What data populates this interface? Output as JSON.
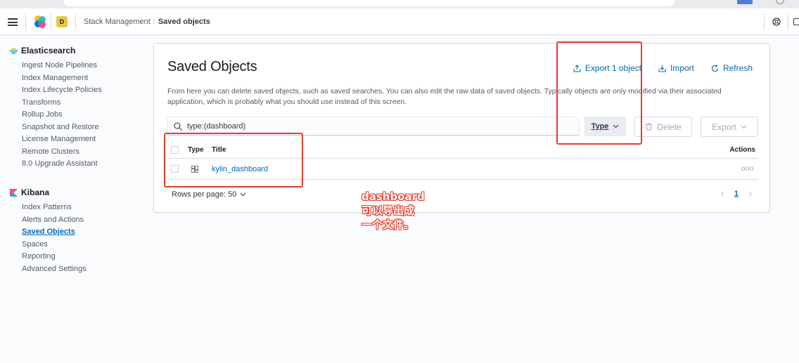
{
  "header": {
    "space_initial": "D",
    "breadcrumbs": [
      "Stack Management",
      "Saved objects"
    ]
  },
  "sidebar": {
    "sections": [
      {
        "title": "Elasticsearch",
        "icon": "elasticsearch-icon",
        "items": [
          "Ingest Node Pipelines",
          "Index Management",
          "Index Lifecycle Policies",
          "Transforms",
          "Rollup Jobs",
          "Snapshot and Restore",
          "License Management",
          "Remote Clusters",
          "8.0 Upgrade Assistant"
        ]
      },
      {
        "title": "Kibana",
        "icon": "kibana-icon",
        "items": [
          "Index Patterns",
          "Alerts and Actions",
          "Saved Objects",
          "Spaces",
          "Reporting",
          "Advanced Settings"
        ],
        "active": "Saved Objects"
      }
    ]
  },
  "main": {
    "title": "Saved Objects",
    "actions": {
      "export_label": "Export 1 object",
      "import_label": "Import",
      "refresh_label": "Refresh"
    },
    "description": "From here you can delete saved objects, such as saved searches. You can also edit the raw data of saved objects. Typically objects are only modified via their associated application, which is probably what you should use instead of this screen.",
    "search": {
      "value": "type:(dashboard)"
    },
    "type_filter_label": "Type",
    "delete_label": "Delete",
    "export_label": "Export",
    "table": {
      "columns": {
        "type": "Type",
        "title": "Title",
        "actions": "Actions"
      },
      "rows": [
        {
          "type_icon": "dashboard-icon",
          "title": "kylin_dashboard",
          "actions": "ooo"
        }
      ]
    },
    "pagination": {
      "rows_per_page": "Rows per page: 50",
      "current_page": "1"
    }
  },
  "annotation": {
    "lines": [
      "dashboard",
      "可以导出成",
      "一个文件。"
    ],
    "color": "#e63a2d"
  },
  "colors": {
    "accent": "#006bb4",
    "annotation_red": "#e63a2d",
    "space_badge": "#e7c846"
  }
}
